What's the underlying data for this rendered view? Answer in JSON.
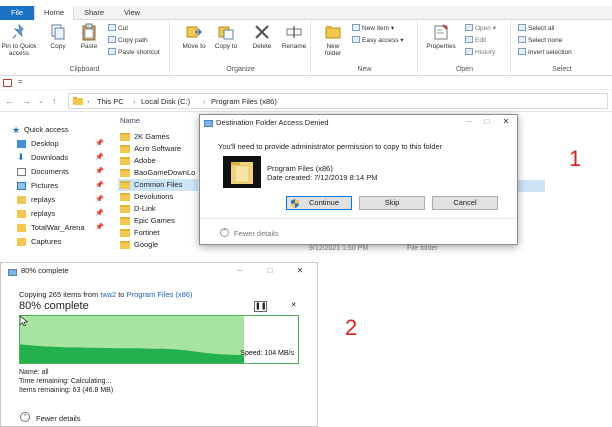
{
  "ribbon": {
    "tabs": [
      "File",
      "Home",
      "Share",
      "View"
    ],
    "clipboard": {
      "pin_label": "Pin to Quick access",
      "copy_label": "Copy",
      "paste_label": "Paste",
      "cut_label": "Cut",
      "copy_path_label": "Copy path",
      "paste_shortcut_label": "Paste shortcut",
      "group_label": "Clipboard"
    },
    "organize": {
      "move_to_label": "Move to",
      "copy_to_label": "Copy to",
      "delete_label": "Delete",
      "rename_label": "Rename",
      "group_label": "Organize"
    },
    "new": {
      "new_folder_label": "New folder",
      "new_item_label": "New item",
      "easy_access_label": "Easy access",
      "group_label": "New"
    },
    "open": {
      "properties_label": "Properties",
      "open_label": "Open",
      "edit_label": "Edit",
      "history_label": "History",
      "group_label": "Open"
    },
    "select": {
      "select_all_label": "Select all",
      "select_none_label": "Select none",
      "invert_label": "Invert selection",
      "group_label": "Select"
    }
  },
  "address": {
    "crumbs": [
      "This PC",
      "Local Disk (C:)",
      "Program Files (x86)"
    ]
  },
  "nav_pane": {
    "quick_access_label": "Quick access",
    "items": [
      {
        "label": "Desktop",
        "icon": "desktop-icon",
        "pinned": true
      },
      {
        "label": "Downloads",
        "icon": "download-icon",
        "pinned": true
      },
      {
        "label": "Documents",
        "icon": "document-icon",
        "pinned": true
      },
      {
        "label": "Pictures",
        "icon": "pictures-icon",
        "pinned": true
      },
      {
        "label": "replays",
        "icon": "folder-icon",
        "pinned": true
      },
      {
        "label": "replays",
        "icon": "folder-icon",
        "pinned": true
      },
      {
        "label": "TotalWar_Arena",
        "icon": "folder-icon",
        "pinned": true
      },
      {
        "label": "Captures",
        "icon": "folder-icon",
        "pinned": false
      }
    ]
  },
  "files": {
    "name_header": "Name",
    "items": [
      "2K Games",
      "Acro Software",
      "Adobe",
      "BaoGameDownLo",
      "Common Files",
      "Devolutions",
      "D-Link",
      "Epic Games",
      "Fortinet",
      "Google"
    ],
    "selected_index": 4,
    "background_date": "9/12/2021 1:50 PM",
    "background_type": "File folder"
  },
  "dialog1": {
    "title": "Destination Folder Access Denied",
    "message": "You'll need to provide administrator permission to copy to this folder",
    "folder_name": "Program Files (x86)",
    "date_created": "Date created: 7/12/2019 8:14 PM",
    "continue_label": "Continue",
    "skip_label": "Skip",
    "cancel_label": "Cancel",
    "fewer_details_label": "Fewer details",
    "shield_color": "#2f6fd0"
  },
  "dialog2": {
    "title": "80% complete",
    "copying_prefix": "Copying 265 items from ",
    "source": "twa2",
    "copying_to": " to ",
    "destination": "Program Files (x86)",
    "percent_label": "80% complete",
    "progress": 0.8,
    "speed_label": "Speed: 104 MB/s",
    "name_line": "Name: all",
    "time_remaining": "Time remaining: Calculating...",
    "items_remaining": "Items remaining: 63 (46.8 MB)",
    "fewer_details_label": "Fewer details",
    "graph_color": "#22b14c",
    "graph_bg": "#a7e3a1"
  },
  "annotations": {
    "one": "1",
    "two": "2",
    "color": "#e02020"
  }
}
